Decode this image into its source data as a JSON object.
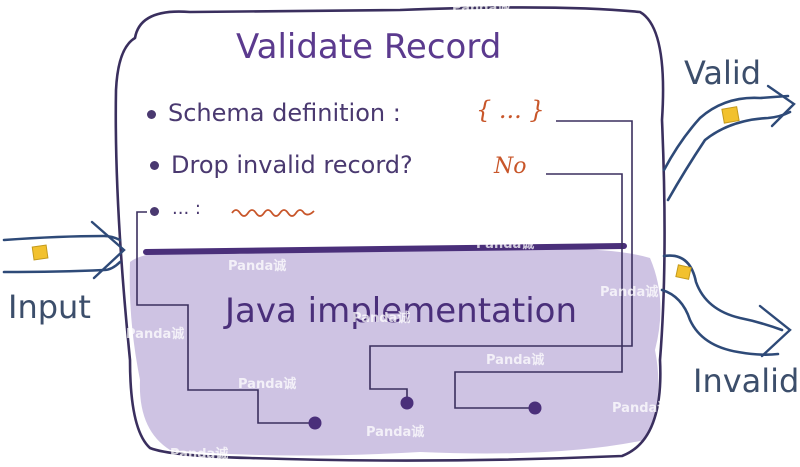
{
  "title": "Validate Record",
  "bullets": [
    {
      "text": "Schema definition :",
      "value": "{ ... }"
    },
    {
      "text": "Drop invalid record?",
      "value": "No"
    },
    {
      "text": "... :"
    }
  ],
  "implementation": "Java implementation",
  "input_label": "Input",
  "valid_label": "Valid",
  "invalid_label": "Invalid",
  "watermark": "Panda诚",
  "colors": {
    "outline": "#3a2f5e",
    "purple_text": "#5b3a8e",
    "shaded": "#c7badd",
    "handwriting": "#c8562a",
    "arrow": "#2e4a78",
    "token": "#f2c12e"
  }
}
